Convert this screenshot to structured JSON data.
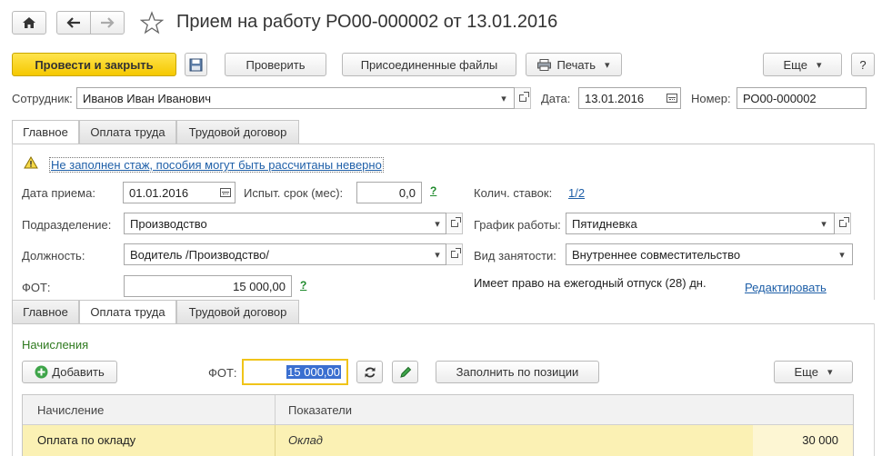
{
  "window": {
    "title": "Прием на работу РО00-000002 от 13.01.2016"
  },
  "toolbar": {
    "post_close": "Провести и закрыть",
    "check": "Проверить",
    "attached_files": "Присоединенные файлы",
    "print": "Печать",
    "more": "Еще",
    "help": "?"
  },
  "header": {
    "employee_label": "Сотрудник:",
    "employee_value": "Иванов Иван Иванович",
    "date_label": "Дата:",
    "date_value": "13.01.2016",
    "number_label": "Номер:",
    "number_value": "РО00-000002"
  },
  "tabs": [
    "Главное",
    "Оплата труда",
    "Трудовой договор"
  ],
  "main": {
    "warning": "Не заполнен стаж, пособия могут быть рассчитаны неверно",
    "hire_date_label": "Дата приема:",
    "hire_date_value": "01.01.2016",
    "probation_label": "Испыт. срок (мес):",
    "probation_value": "0,0",
    "q_mark": "?",
    "rates_label": "Колич. ставок:",
    "rates_value": "1/2",
    "department_label": "Подразделение:",
    "department_value": "Производство",
    "schedule_label": "График работы:",
    "schedule_value": "Пятидневка",
    "position_label": "Должность:",
    "position_value": "Водитель /Производство/",
    "employment_label": "Вид занятости:",
    "employment_value": "Внутреннее совместительство",
    "fot_label": "ФОТ:",
    "fot_value": "15 000,00",
    "vacation_text": "Имеет право на ежегодный отпуск (28) дн.",
    "edit_link": "Редактировать"
  },
  "payroll": {
    "section_title": "Начисления",
    "add_button": "Добавить",
    "fot_label": "ФОТ:",
    "fot_value": "15 000,00",
    "fill_button": "Заполнить по позиции",
    "more_button": "Еще",
    "columns": [
      "Начисление",
      "Показатели"
    ],
    "rows": [
      {
        "accrual": "Оплата по окладу",
        "indicator": "Оклад",
        "value": "30 000"
      }
    ]
  },
  "colors": {
    "accent_yellow": "#f5c800",
    "link_blue": "#1e5fa8",
    "green_q": "#1f8a2c",
    "selected_row": "#fbf1b4",
    "section_green": "#2f7a1f"
  }
}
